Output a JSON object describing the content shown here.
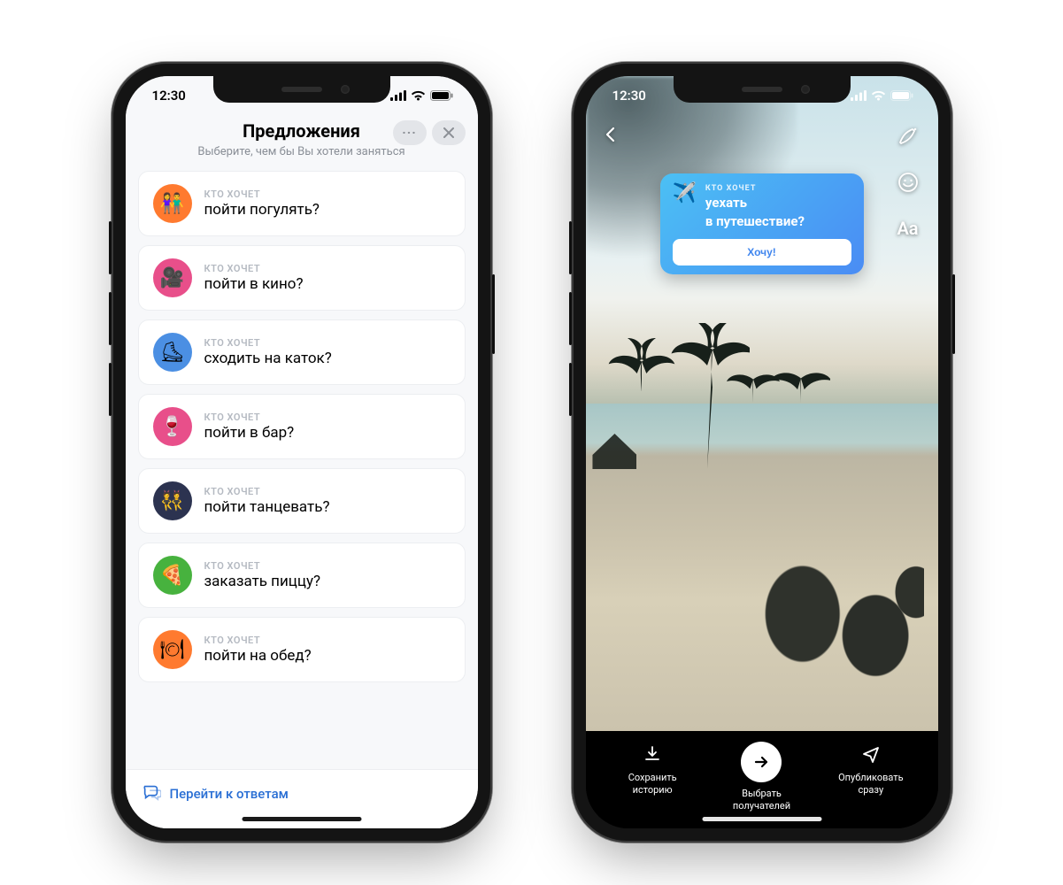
{
  "status": {
    "time": "12:30"
  },
  "left": {
    "title": "Предложения",
    "subtitle": "Выберите, чем бы Вы хотели заняться",
    "kto": "КТО ХОЧЕТ",
    "items": [
      {
        "emoji": "👫",
        "bg": "#ff7a2f",
        "q": "пойти погулять?"
      },
      {
        "emoji": "🎥",
        "bg": "#e84f8a",
        "q": "пойти в кино?"
      },
      {
        "emoji": "⛸",
        "bg": "#4b8fe3",
        "q": "сходить на каток?"
      },
      {
        "emoji": "🍷",
        "bg": "#e84f8a",
        "q": "пойти в бар?"
      },
      {
        "emoji": "👯",
        "bg": "#2c3350",
        "q": "пойти танцевать?"
      },
      {
        "emoji": "🍕",
        "bg": "#47b23e",
        "q": "заказать пиццу?"
      },
      {
        "emoji": "🍽",
        "bg": "#ff7a2f",
        "q": "пойти на обед?"
      }
    ],
    "answers": "Перейти к ответам"
  },
  "right": {
    "sticker": {
      "label": "КТО ХОЧЕТ",
      "line1": "уехать",
      "line2": "в путешествие?",
      "button": "Хочу!"
    },
    "actions": {
      "save": "Сохранить\nисторию",
      "select": "Выбрать\nполучателей",
      "publish": "Опубликовать\nсразу"
    }
  }
}
